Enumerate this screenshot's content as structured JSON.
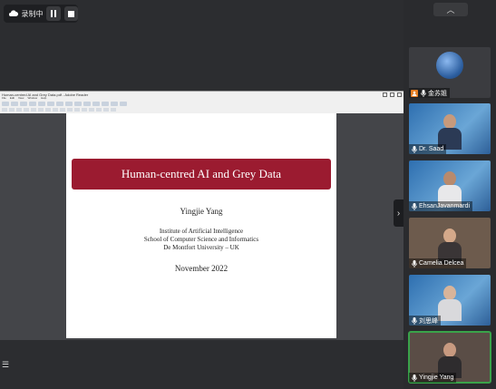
{
  "recording": {
    "label": "录制中",
    "pause_label": "pause",
    "stop_label": "stop"
  },
  "shared_screen": {
    "window_title": "Human-centred AI and Grey Data.pdf - Adobe Reader",
    "menu": [
      "File",
      "Edit",
      "View",
      "Window",
      "Help"
    ],
    "slide": {
      "title": "Human-centred AI and Grey Data",
      "author": "Yingjie Yang",
      "affiliation": [
        "Institute of Artificial Intelligence",
        "School of Computer Science and Informatics",
        "De Montfort University – UK"
      ],
      "date": "November 2022"
    }
  },
  "participants": [
    {
      "name": "金苏姐",
      "mic": "on",
      "host": true
    },
    {
      "name": "Dr. Saad",
      "mic": "on",
      "host": false
    },
    {
      "name": "EhsanJavanmardi",
      "mic": "on",
      "host": false
    },
    {
      "name": "Camelia Delcea",
      "mic": "on",
      "host": false
    },
    {
      "name": "刘思峰",
      "mic": "on",
      "host": false
    },
    {
      "name": "Yingjie Yang",
      "mic": "on",
      "host": false,
      "active": true
    }
  ],
  "icons": {
    "rail_collapse": "chevron-up-icon",
    "panel_toggle": "chevron-right-icon",
    "list": "list-icon"
  }
}
